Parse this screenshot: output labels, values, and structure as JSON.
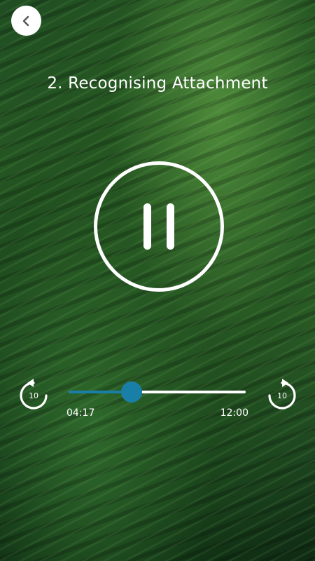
{
  "header": {
    "back_icon": "chevron-left-icon"
  },
  "track": {
    "title": "2. Recognising Attachment"
  },
  "controls": {
    "state_icon": "pause-icon",
    "skip_back_label": "10",
    "skip_forward_label": "10",
    "skip_back_icon": "rotate-ccw-icon",
    "skip_forward_icon": "rotate-cw-icon"
  },
  "progress": {
    "elapsed": "04:17",
    "total": "12:00",
    "fraction": 0.3569
  },
  "colors": {
    "accent": "#1a7fa6",
    "text": "#ffffff",
    "track": "#ffffff"
  }
}
